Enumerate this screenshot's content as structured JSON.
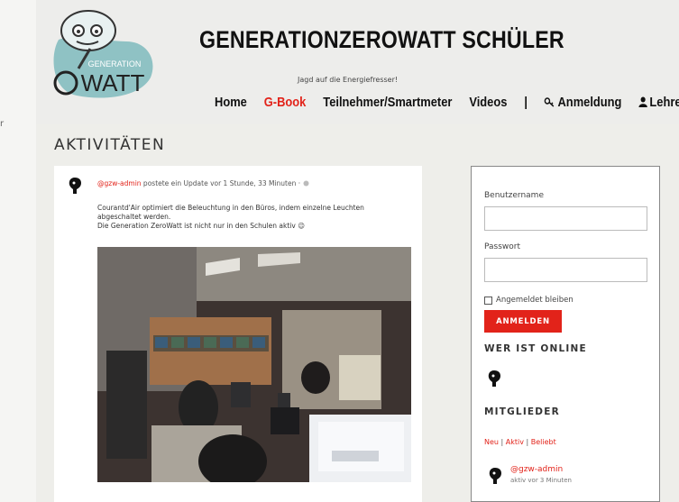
{
  "site": {
    "title": "GENERATIONZEROWATT SCHÜLER",
    "tagline": "Jagd auf die Energiefresser!",
    "logo_line1": "GENERATION",
    "logo_line2": "WATT"
  },
  "left_strip": {
    "fragment": "r"
  },
  "nav": {
    "items": [
      "Home",
      "G-Book",
      "Teilnehmer/Smartmeter",
      "Videos"
    ],
    "separator": "|",
    "login": "Anmeldung",
    "teacher": "Lehrer",
    "active": "G-Book"
  },
  "main": {
    "section_title": "AKTIVITÄTEN",
    "activity": {
      "user": "@gzw-admin",
      "header_rest": " postete ein Update vor 1 Stunde, 33 Minuten · ",
      "body_line1": "Courantd'Air optimiert die Beleuchtung in den Büros, indem einzelne Leuchten abgeschaltet werden.",
      "body_line2": "Die Generation ZeroWatt ist nicht nur in den Schulen aktiv 😉"
    }
  },
  "sidebar": {
    "username_label": "Benutzername",
    "password_label": "Passwort",
    "remember_label": "Angemeldet bleiben",
    "login_button": "ANMELDEN",
    "online_title": "WER IST ONLINE",
    "members_title": "MITGLIEDER",
    "member_tabs": [
      "Neu",
      "Aktiv",
      "Beliebt"
    ],
    "member": {
      "name": "@gzw-admin",
      "status": "aktiv vor 3 Minuten"
    }
  },
  "colors": {
    "accent": "#e2231a",
    "logo_blob": "#8fc2c4"
  }
}
